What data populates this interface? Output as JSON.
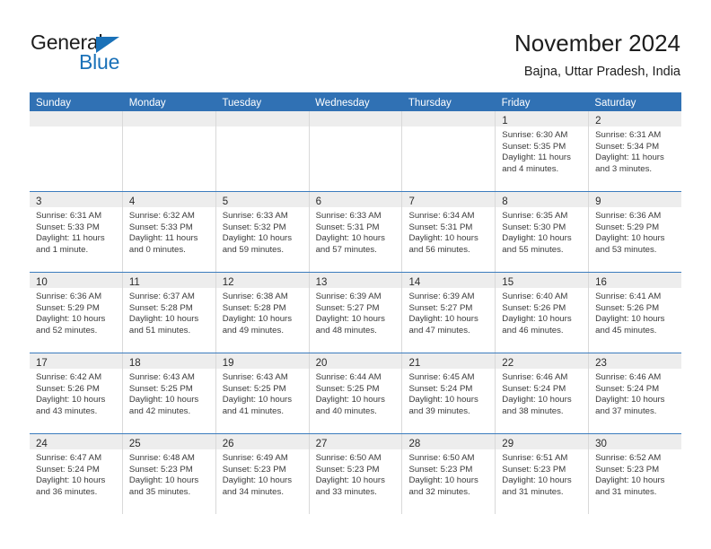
{
  "brand": {
    "word_one": "General",
    "word_two": "Blue",
    "triangle_icon": "blue-triangle-icon",
    "color_dark": "#1d1d1d",
    "color_blue": "#1a71b8"
  },
  "header": {
    "title": "November 2024",
    "subtitle": "Bajna, Uttar Pradesh, India",
    "header_bg": "#3071b4",
    "header_text": "#ffffff"
  },
  "weekdays": [
    "Sunday",
    "Monday",
    "Tuesday",
    "Wednesday",
    "Thursday",
    "Friday",
    "Saturday"
  ],
  "weeks": [
    [
      {
        "day": "",
        "empty": true
      },
      {
        "day": "",
        "empty": true
      },
      {
        "day": "",
        "empty": true
      },
      {
        "day": "",
        "empty": true
      },
      {
        "day": "",
        "empty": true
      },
      {
        "day": "1",
        "sunrise": "Sunrise: 6:30 AM",
        "sunset": "Sunset: 5:35 PM",
        "daylight_1": "Daylight: 11 hours",
        "daylight_2": "and 4 minutes."
      },
      {
        "day": "2",
        "sunrise": "Sunrise: 6:31 AM",
        "sunset": "Sunset: 5:34 PM",
        "daylight_1": "Daylight: 11 hours",
        "daylight_2": "and 3 minutes."
      }
    ],
    [
      {
        "day": "3",
        "sunrise": "Sunrise: 6:31 AM",
        "sunset": "Sunset: 5:33 PM",
        "daylight_1": "Daylight: 11 hours",
        "daylight_2": "and 1 minute."
      },
      {
        "day": "4",
        "sunrise": "Sunrise: 6:32 AM",
        "sunset": "Sunset: 5:33 PM",
        "daylight_1": "Daylight: 11 hours",
        "daylight_2": "and 0 minutes."
      },
      {
        "day": "5",
        "sunrise": "Sunrise: 6:33 AM",
        "sunset": "Sunset: 5:32 PM",
        "daylight_1": "Daylight: 10 hours",
        "daylight_2": "and 59 minutes."
      },
      {
        "day": "6",
        "sunrise": "Sunrise: 6:33 AM",
        "sunset": "Sunset: 5:31 PM",
        "daylight_1": "Daylight: 10 hours",
        "daylight_2": "and 57 minutes."
      },
      {
        "day": "7",
        "sunrise": "Sunrise: 6:34 AM",
        "sunset": "Sunset: 5:31 PM",
        "daylight_1": "Daylight: 10 hours",
        "daylight_2": "and 56 minutes."
      },
      {
        "day": "8",
        "sunrise": "Sunrise: 6:35 AM",
        "sunset": "Sunset: 5:30 PM",
        "daylight_1": "Daylight: 10 hours",
        "daylight_2": "and 55 minutes."
      },
      {
        "day": "9",
        "sunrise": "Sunrise: 6:36 AM",
        "sunset": "Sunset: 5:29 PM",
        "daylight_1": "Daylight: 10 hours",
        "daylight_2": "and 53 minutes."
      }
    ],
    [
      {
        "day": "10",
        "sunrise": "Sunrise: 6:36 AM",
        "sunset": "Sunset: 5:29 PM",
        "daylight_1": "Daylight: 10 hours",
        "daylight_2": "and 52 minutes."
      },
      {
        "day": "11",
        "sunrise": "Sunrise: 6:37 AM",
        "sunset": "Sunset: 5:28 PM",
        "daylight_1": "Daylight: 10 hours",
        "daylight_2": "and 51 minutes."
      },
      {
        "day": "12",
        "sunrise": "Sunrise: 6:38 AM",
        "sunset": "Sunset: 5:28 PM",
        "daylight_1": "Daylight: 10 hours",
        "daylight_2": "and 49 minutes."
      },
      {
        "day": "13",
        "sunrise": "Sunrise: 6:39 AM",
        "sunset": "Sunset: 5:27 PM",
        "daylight_1": "Daylight: 10 hours",
        "daylight_2": "and 48 minutes."
      },
      {
        "day": "14",
        "sunrise": "Sunrise: 6:39 AM",
        "sunset": "Sunset: 5:27 PM",
        "daylight_1": "Daylight: 10 hours",
        "daylight_2": "and 47 minutes."
      },
      {
        "day": "15",
        "sunrise": "Sunrise: 6:40 AM",
        "sunset": "Sunset: 5:26 PM",
        "daylight_1": "Daylight: 10 hours",
        "daylight_2": "and 46 minutes."
      },
      {
        "day": "16",
        "sunrise": "Sunrise: 6:41 AM",
        "sunset": "Sunset: 5:26 PM",
        "daylight_1": "Daylight: 10 hours",
        "daylight_2": "and 45 minutes."
      }
    ],
    [
      {
        "day": "17",
        "sunrise": "Sunrise: 6:42 AM",
        "sunset": "Sunset: 5:26 PM",
        "daylight_1": "Daylight: 10 hours",
        "daylight_2": "and 43 minutes."
      },
      {
        "day": "18",
        "sunrise": "Sunrise: 6:43 AM",
        "sunset": "Sunset: 5:25 PM",
        "daylight_1": "Daylight: 10 hours",
        "daylight_2": "and 42 minutes."
      },
      {
        "day": "19",
        "sunrise": "Sunrise: 6:43 AM",
        "sunset": "Sunset: 5:25 PM",
        "daylight_1": "Daylight: 10 hours",
        "daylight_2": "and 41 minutes."
      },
      {
        "day": "20",
        "sunrise": "Sunrise: 6:44 AM",
        "sunset": "Sunset: 5:25 PM",
        "daylight_1": "Daylight: 10 hours",
        "daylight_2": "and 40 minutes."
      },
      {
        "day": "21",
        "sunrise": "Sunrise: 6:45 AM",
        "sunset": "Sunset: 5:24 PM",
        "daylight_1": "Daylight: 10 hours",
        "daylight_2": "and 39 minutes."
      },
      {
        "day": "22",
        "sunrise": "Sunrise: 6:46 AM",
        "sunset": "Sunset: 5:24 PM",
        "daylight_1": "Daylight: 10 hours",
        "daylight_2": "and 38 minutes."
      },
      {
        "day": "23",
        "sunrise": "Sunrise: 6:46 AM",
        "sunset": "Sunset: 5:24 PM",
        "daylight_1": "Daylight: 10 hours",
        "daylight_2": "and 37 minutes."
      }
    ],
    [
      {
        "day": "24",
        "sunrise": "Sunrise: 6:47 AM",
        "sunset": "Sunset: 5:24 PM",
        "daylight_1": "Daylight: 10 hours",
        "daylight_2": "and 36 minutes."
      },
      {
        "day": "25",
        "sunrise": "Sunrise: 6:48 AM",
        "sunset": "Sunset: 5:23 PM",
        "daylight_1": "Daylight: 10 hours",
        "daylight_2": "and 35 minutes."
      },
      {
        "day": "26",
        "sunrise": "Sunrise: 6:49 AM",
        "sunset": "Sunset: 5:23 PM",
        "daylight_1": "Daylight: 10 hours",
        "daylight_2": "and 34 minutes."
      },
      {
        "day": "27",
        "sunrise": "Sunrise: 6:50 AM",
        "sunset": "Sunset: 5:23 PM",
        "daylight_1": "Daylight: 10 hours",
        "daylight_2": "and 33 minutes."
      },
      {
        "day": "28",
        "sunrise": "Sunrise: 6:50 AM",
        "sunset": "Sunset: 5:23 PM",
        "daylight_1": "Daylight: 10 hours",
        "daylight_2": "and 32 minutes."
      },
      {
        "day": "29",
        "sunrise": "Sunrise: 6:51 AM",
        "sunset": "Sunset: 5:23 PM",
        "daylight_1": "Daylight: 10 hours",
        "daylight_2": "and 31 minutes."
      },
      {
        "day": "30",
        "sunrise": "Sunrise: 6:52 AM",
        "sunset": "Sunset: 5:23 PM",
        "daylight_1": "Daylight: 10 hours",
        "daylight_2": "and 31 minutes."
      }
    ]
  ]
}
